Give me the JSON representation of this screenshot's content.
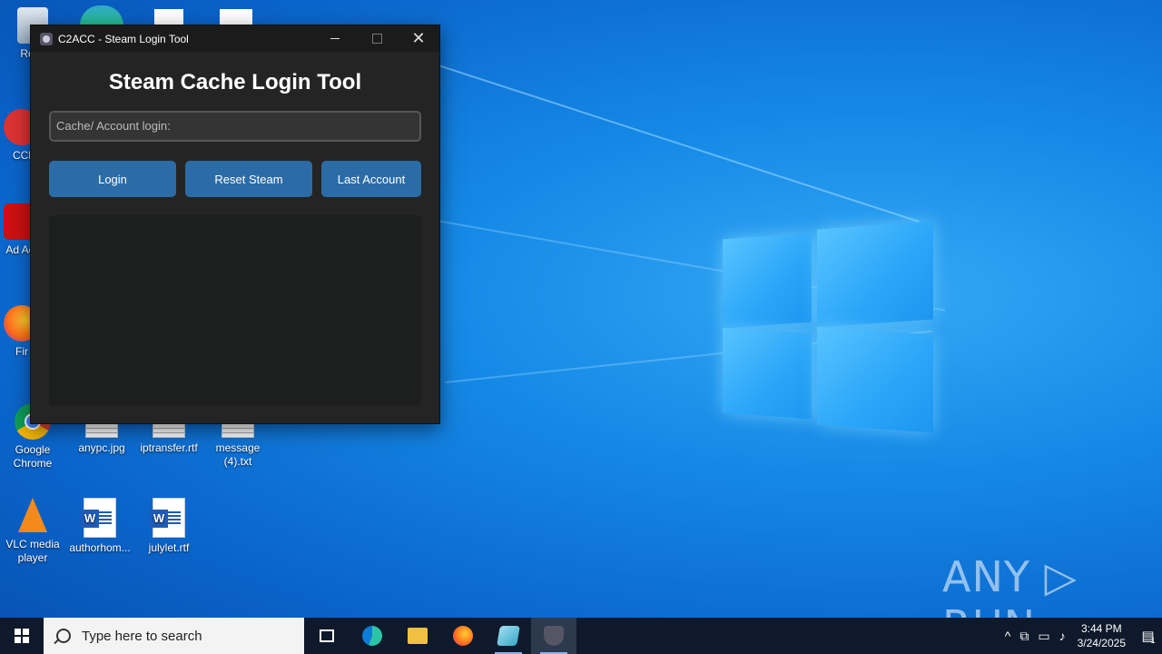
{
  "desktop": {
    "icons": [
      {
        "label": "Recy"
      },
      {
        "label": "CCl"
      },
      {
        "label": "Ad Acr"
      },
      {
        "label": "Fir"
      },
      {
        "label": "Google Chrome"
      },
      {
        "label": "anypc.jpg"
      },
      {
        "label": "iptransfer.rtf"
      },
      {
        "label": "message (4).txt"
      },
      {
        "label": "VLC media player"
      },
      {
        "label": "authorhom..."
      },
      {
        "label": "julylet.rtf"
      }
    ],
    "watermark": "ANY ▷ RUN"
  },
  "window": {
    "title": "C2ACC - Steam Login Tool",
    "heading": "Steam Cache Login Tool",
    "input_placeholder": "Cache/ Account login:",
    "buttons": {
      "login": "Login",
      "reset": "Reset Steam",
      "last": "Last Account"
    },
    "controls": {
      "minimize": "—",
      "maximize": "☐",
      "close": "✕"
    }
  },
  "taskbar": {
    "search_placeholder": "Type here to search",
    "time": "3:44 PM",
    "date": "3/24/2025",
    "notification_count": "1"
  },
  "colors": {
    "desktop_blue": "#0a63c9",
    "button_blue": "#2b6ca6",
    "window_bg": "#242424"
  }
}
